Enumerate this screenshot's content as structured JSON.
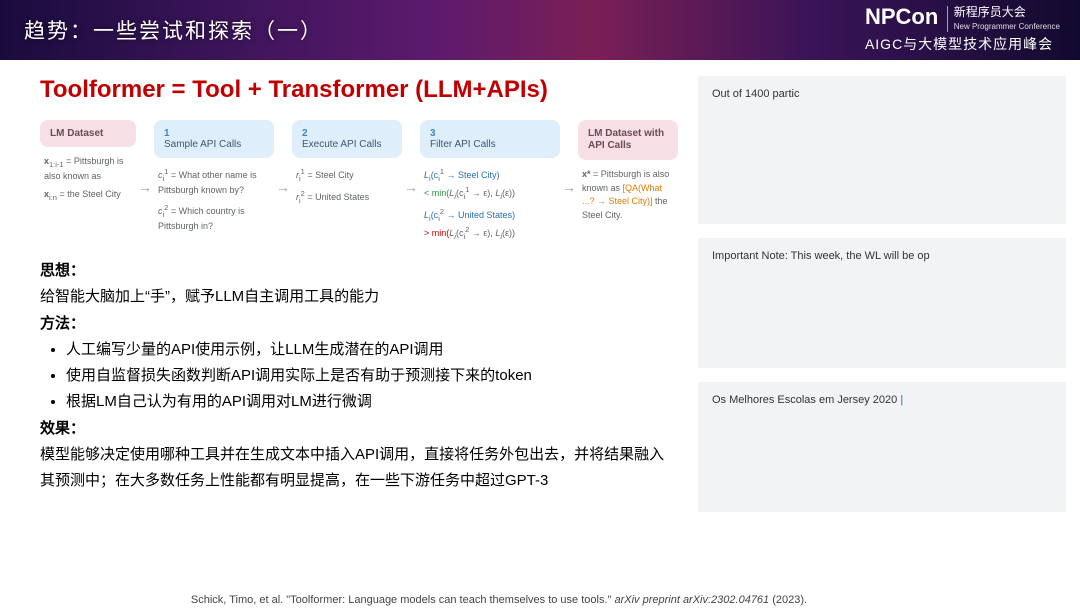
{
  "header": {
    "title": "趋势：一些尝试和探索（一）",
    "logo_np": "NP",
    "logo_con": "Con",
    "logo_cn": "新程序员大会",
    "logo_en": "New Programmer Conference",
    "subline": "AIGC与大模型技术应用峰会"
  },
  "slide": {
    "title": "Toolformer = Tool + Transformer  (LLM+APIs)"
  },
  "diagram": {
    "col0": {
      "box": "LM Dataset",
      "r1a": "x",
      "r1a_sub": "1:i-1",
      "r1b": " = Pittsburgh is also known as",
      "r2a": "x",
      "r2a_sub": "i:n",
      "r2b": " = the Steel City"
    },
    "col1": {
      "num": "1",
      "label": "Sample API Calls",
      "r1a": "c",
      "r1b": " = What other name is Pittsburgh known by?",
      "r2a": "c",
      "r2b": " = Which country is Pittsburgh in?"
    },
    "col2": {
      "num": "2",
      "label": "Execute API Calls",
      "r1": "r",
      "r1b": " = Steel City",
      "r2": "r",
      "r2b": " = United States"
    },
    "col3": {
      "num": "3",
      "label": "Filter API Calls",
      "r1a": "L",
      "r1b": "(c",
      "r1c": " → Steel City)",
      "r1d": "< min(",
      "r1e": "(c",
      "r1f": " → ε), ",
      "r1g": "(ε))",
      "r2a": "L",
      "r2b": "(c",
      "r2c": " → United States)",
      "r2d": "> min(",
      "r2e": "(c",
      "r2f": " → ε), ",
      "r2g": "(ε))"
    },
    "col4": {
      "box": "LM Dataset with API Calls",
      "t1": "x*",
      "t2": " = Pittsburgh is also known as ",
      "t3": "[QA(What ...? → Steel City)]",
      "t4": " the Steel City."
    },
    "arrow": "→"
  },
  "content": {
    "h1": "思想：",
    "p1": "给智能大脑加上“手”，赋予LLM自主调用工具的能力",
    "h2": "方法：",
    "li1": "人工编写少量的API使用示例，让LLM生成潜在的API调用",
    "li2": "使用自监督损失函数判断API调用实际上是否有助于预测接下来的token",
    "li3": "根据LM自己认为有用的API调用对LM进行微调",
    "h3": "效果：",
    "p3": "模型能够决定使用哪种工具并在生成文本中插入API调用，直接将任务外包出去，并将结果融入其预测中；在大多数任务上性能都有明显提高，在一些下游任务中超过GPT-3"
  },
  "citation": {
    "pre": "Schick, Timo, et al. \"Toolformer: Language models can teach themselves to use tools.\" ",
    "ital": "arXiv preprint arXiv:2302.04761",
    "post": " (2023)."
  },
  "side": {
    "card1": "Out of 1400 partic",
    "card2": "Important Note: This week, the WL will be op",
    "card3a": "Os Melhores Escolas em Jersey 2020 ",
    "card3b": "|"
  }
}
